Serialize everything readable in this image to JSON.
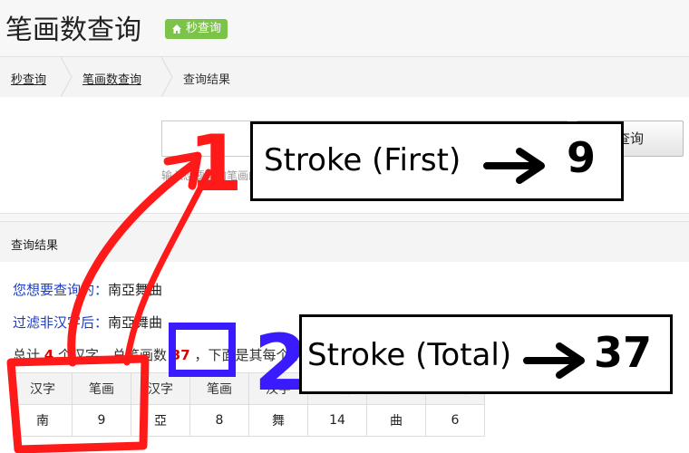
{
  "header": {
    "title": "笔画数查询",
    "badge_label": "秒查询"
  },
  "breadcrumb": {
    "items": [
      "秒查询",
      "笔画数查询",
      "查询结果"
    ]
  },
  "search": {
    "button_label": "查询",
    "hint": "输入您要查询笔画的汉字（简体字、繁体字均可），不超过200个"
  },
  "results": {
    "section_title": "查询结果",
    "query_label": "您想要查询的：",
    "query_value": "南亞舞曲",
    "filtered_label": "过滤非汉字后：",
    "filtered_value": "南亞舞曲",
    "summary": {
      "prefix": "总计",
      "char_count": "4",
      "mid": "个汉字，总笔画数",
      "stroke_total": "37",
      "suffix": "，下面是其每个字的笔画（点击单个汉字可查看其详细解释）："
    },
    "table": {
      "headers": [
        "汉字",
        "笔画",
        "汉字",
        "笔画",
        "汉字",
        "笔画",
        "汉字",
        "笔画"
      ],
      "cells": [
        "南",
        "9",
        "亞",
        "8",
        "舞",
        "14",
        "曲",
        "6"
      ]
    }
  },
  "annotations": {
    "label_1": "1",
    "label_2": "2",
    "box_1_text": "Stroke (First)",
    "box_1_value": "9",
    "box_2_text": "Stroke (Total)",
    "box_2_value": "37",
    "colors": {
      "red": "#ff1a1a",
      "blue": "#3a1aff",
      "black": "#000000"
    }
  }
}
